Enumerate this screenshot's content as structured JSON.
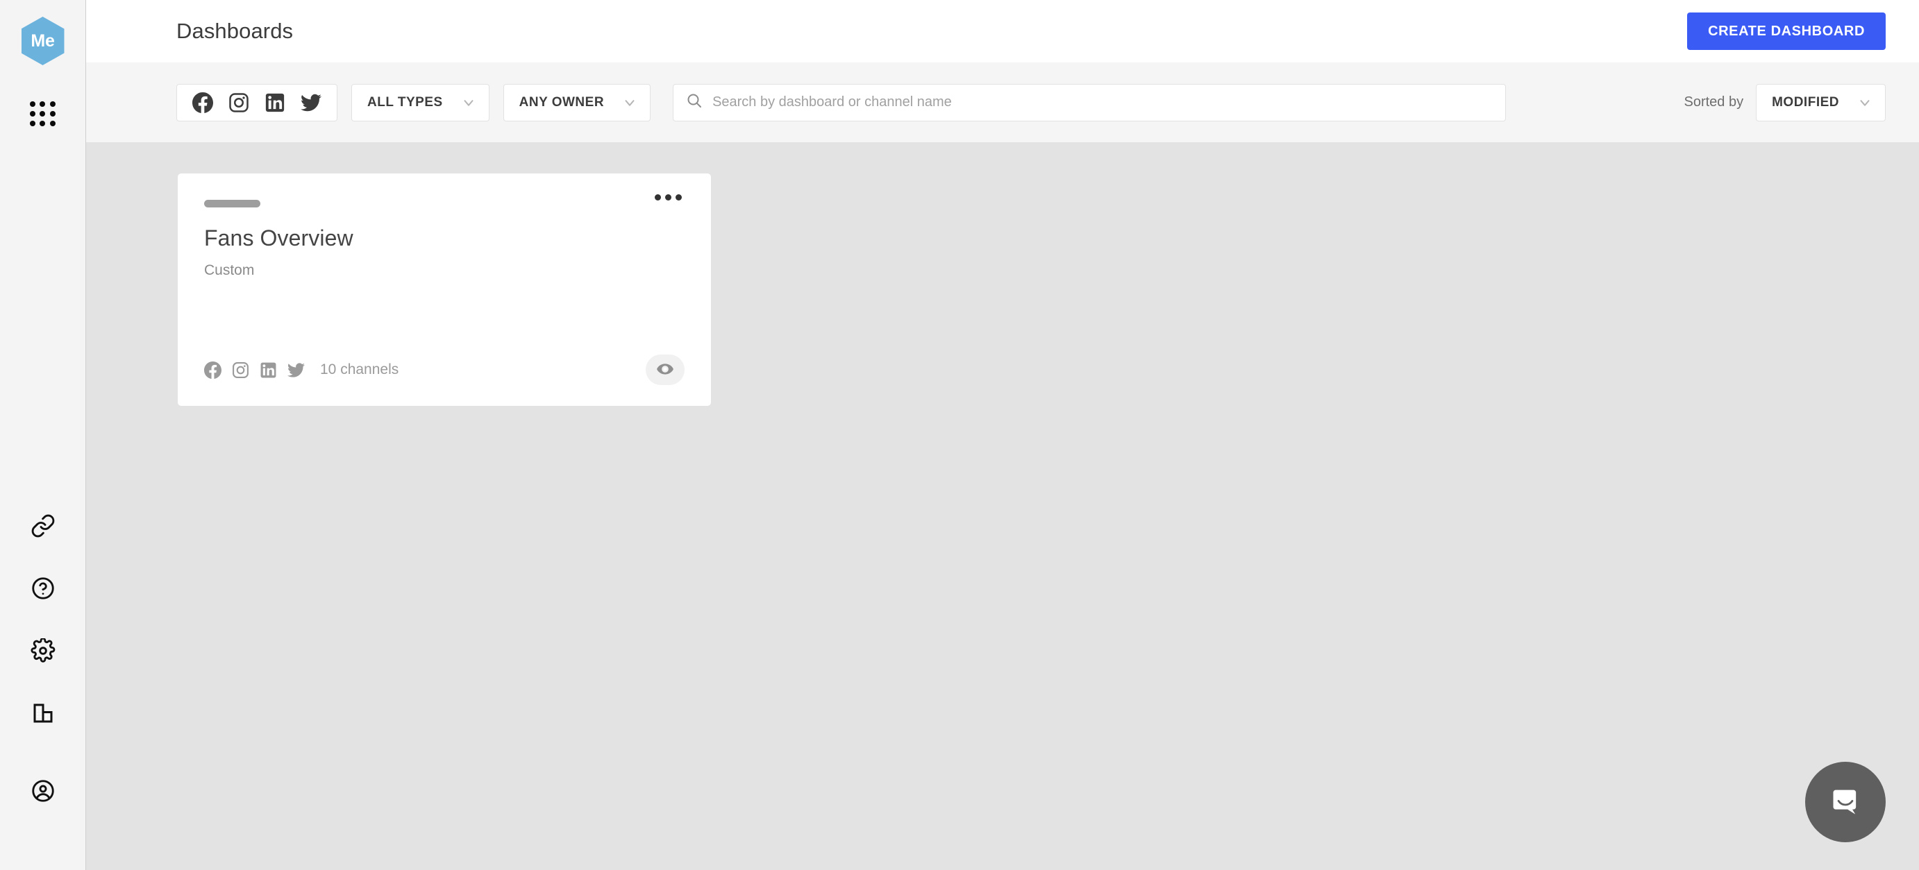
{
  "brand": {
    "logo_text": "Me",
    "logo_color": "#6bb3dd"
  },
  "sidebar": {
    "apps_icon": "apps-grid-icon",
    "items": [
      {
        "icon": "link-icon",
        "name": "integrations"
      },
      {
        "icon": "question-circle-icon",
        "name": "help"
      },
      {
        "icon": "gear-icon",
        "name": "settings"
      },
      {
        "icon": "building-icon",
        "name": "organization"
      },
      {
        "icon": "account-circle-icon",
        "name": "account"
      }
    ]
  },
  "header": {
    "title": "Dashboards",
    "create_button": "CREATE DASHBOARD",
    "create_button_color": "#3b5bf5"
  },
  "filters": {
    "networks": [
      {
        "name": "facebook",
        "icon": "facebook-icon"
      },
      {
        "name": "instagram",
        "icon": "instagram-icon"
      },
      {
        "name": "linkedin",
        "icon": "linkedin-icon"
      },
      {
        "name": "twitter",
        "icon": "twitter-icon"
      }
    ],
    "type_filter": {
      "label": "ALL TYPES",
      "options": [
        "ALL TYPES"
      ]
    },
    "owner_filter": {
      "label": "ANY OWNER",
      "options": [
        "ANY OWNER"
      ]
    },
    "search": {
      "value": "",
      "placeholder": "Search by dashboard or channel name"
    },
    "sort": {
      "label": "Sorted by",
      "value": "MODIFIED",
      "options": [
        "MODIFIED"
      ]
    }
  },
  "dashboards": [
    {
      "title": "Fans Overview",
      "subtitle": "Custom",
      "channels_count": "10 channels",
      "networks": [
        "facebook-icon",
        "instagram-icon",
        "linkedin-icon",
        "twitter-icon"
      ],
      "menu_icon": "more-options-icon",
      "preview_icon": "eye-icon"
    }
  ],
  "chat": {
    "icon": "chat-bubble-icon",
    "color": "#5f5f5f"
  }
}
